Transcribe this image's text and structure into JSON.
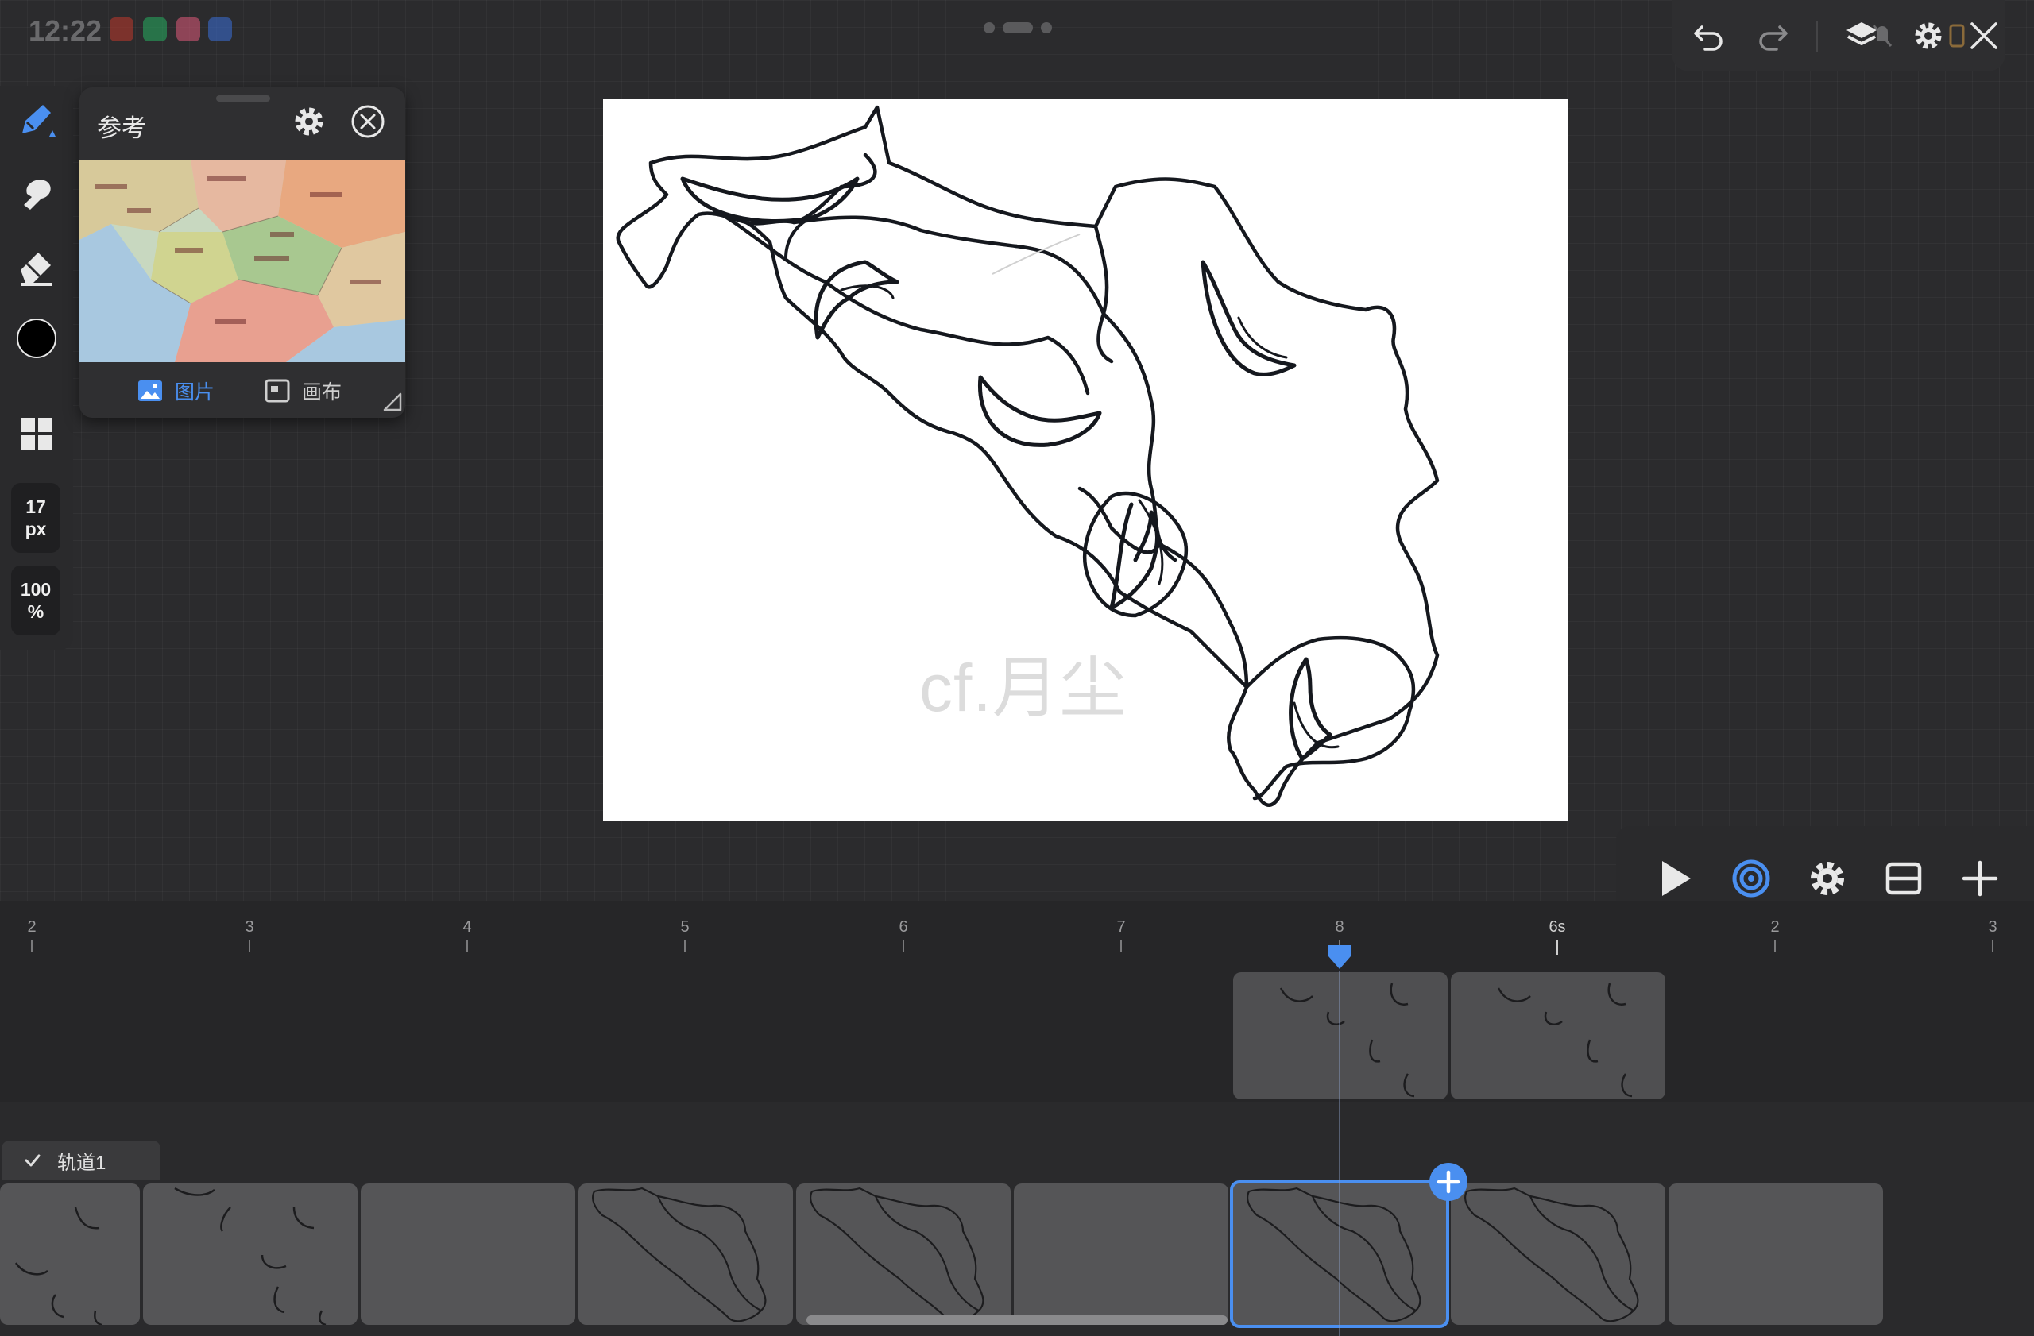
{
  "status_bar": {
    "time": "12:22"
  },
  "reference_panel": {
    "title": "参考",
    "tab_picture": "图片",
    "tab_canvas": "画布"
  },
  "tool_rail": {
    "brush_size": "17",
    "brush_size_unit": "px",
    "opacity": "100",
    "opacity_unit": "%",
    "color": "#000000"
  },
  "canvas": {
    "watermark": "cf.月尘"
  },
  "timeline": {
    "ruler_labels": [
      "2",
      "3",
      "4",
      "5",
      "6",
      "7",
      "8",
      "6s",
      "2",
      "3"
    ],
    "track_name": "轨道1",
    "selected_frame_index": 6
  },
  "colors": {
    "accent": "#4a8ff0",
    "background": "#2b2b2d"
  }
}
